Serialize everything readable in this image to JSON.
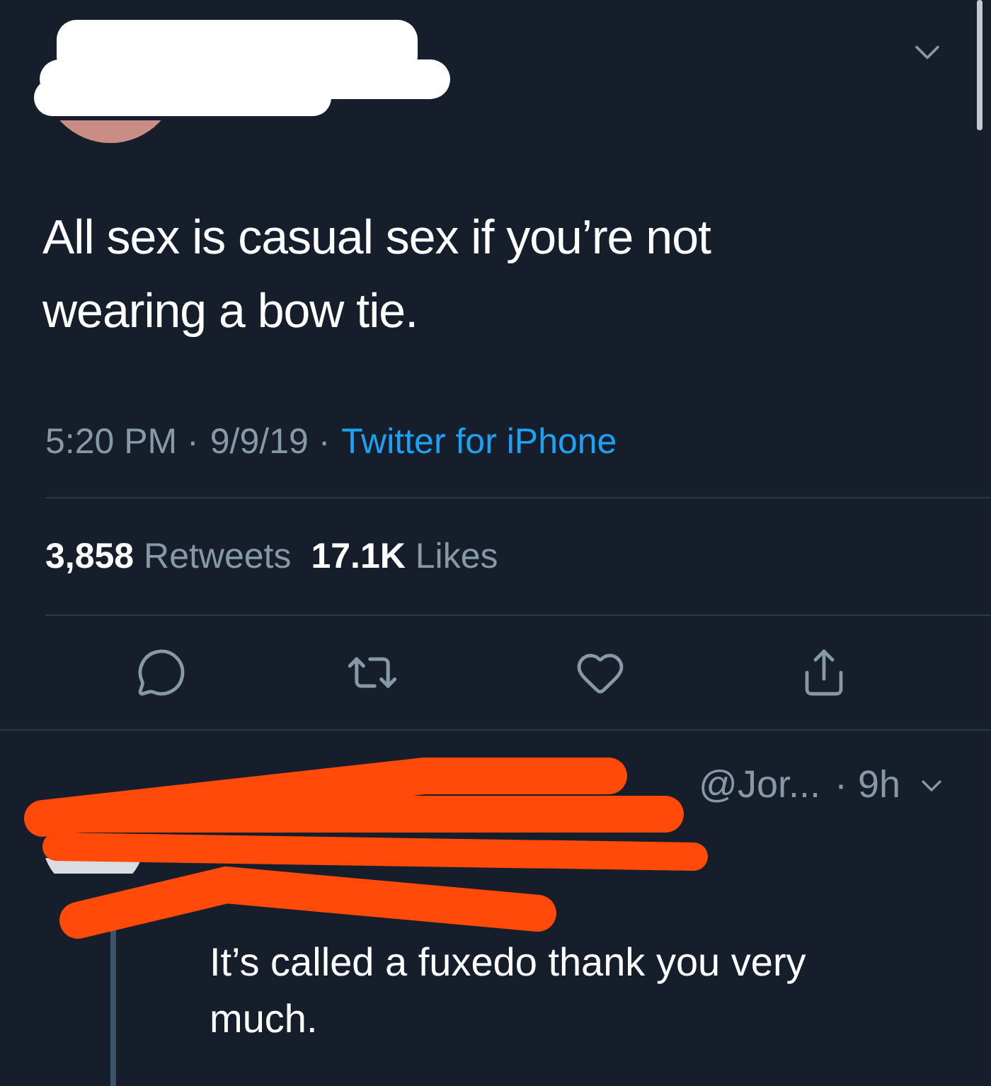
{
  "tweet": {
    "text": "All sex is casual sex if you’re not wearing a bow tie.",
    "time": "5:20 PM ·",
    "date": "9/9/19 ·",
    "source": "Twitter for iPhone",
    "stats": [
      {
        "count": "3,858",
        "label": "Retweets"
      },
      {
        "count": "17.1K",
        "label": "Likes"
      }
    ]
  },
  "reply": {
    "handle": "@Jor...",
    "age": "· 9h",
    "text": "It’s called a fuxedo thank you very much."
  }
}
